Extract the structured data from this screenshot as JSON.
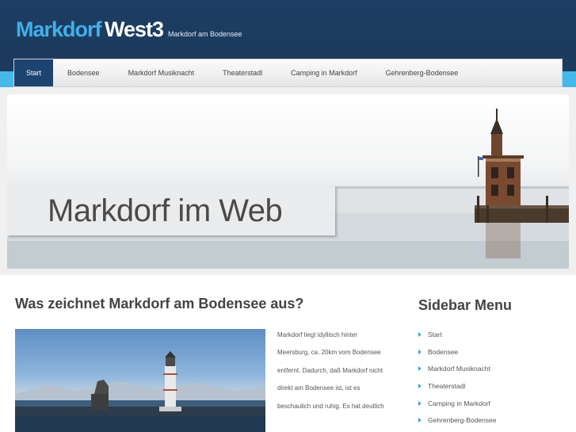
{
  "header": {
    "logo_part1": "Markdorf",
    "logo_part2": "West3",
    "tagline": "Markdorf am Bodensee"
  },
  "nav": {
    "items": [
      "Start",
      "Bodensee",
      "Markdorf Musiknacht",
      "Theaterstadl",
      "Camping in Markdorf",
      "Gehrenberg-Bodensee"
    ],
    "active": "Start"
  },
  "hero": {
    "title": "Markdorf im Web"
  },
  "main": {
    "heading": "Was zeichnet Markdorf am Bodensee aus?",
    "paragraph": "Markdorf liegt idyllisch hinter Meersburg, ca. 20km vom Bodensee entfernt. Dadurch, daß Markdorf nicht direkt am Bodensee ist, ist es beschaulich und ruhig. Es hat deutlich"
  },
  "sidebar": {
    "heading": "Sidebar Menu",
    "items": [
      "Start",
      "Bodensee",
      "Markdorf Musiknacht",
      "Theaterstadl",
      "Camping in Markdorf",
      "Gehrenberg-Bodensee"
    ]
  },
  "colors": {
    "header_bg": "#1d3d62",
    "accent": "#3fb0ea",
    "nav_active": "#1d4470"
  }
}
